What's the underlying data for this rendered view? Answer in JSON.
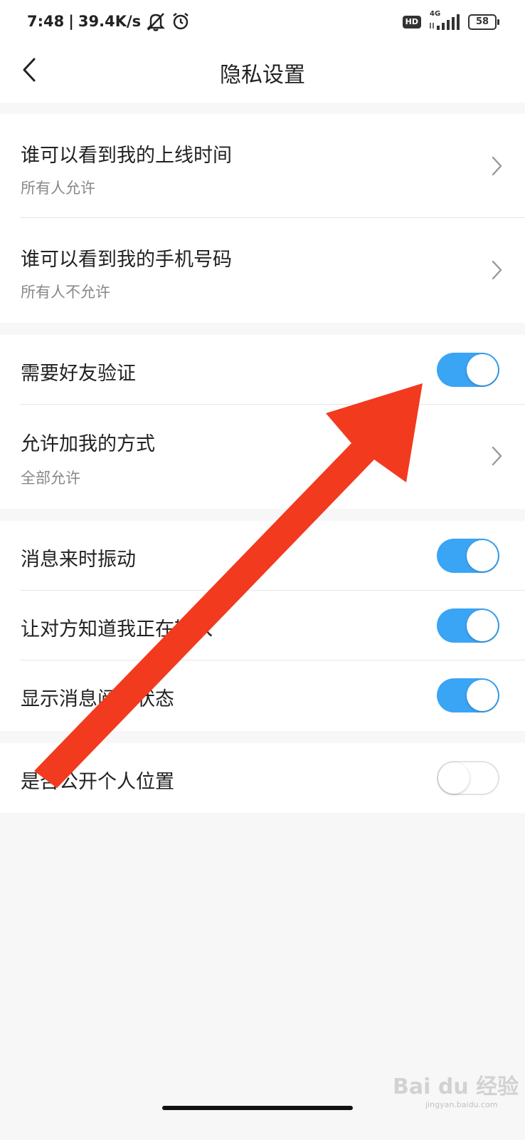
{
  "status_bar": {
    "time": "7:48",
    "separator": "|",
    "net_speed": "39.4K/s",
    "hd_label": "HD",
    "network_type": "4G",
    "battery": "58",
    "icons": [
      "mute-icon",
      "alarm-icon",
      "signal-icon",
      "battery-icon"
    ]
  },
  "header": {
    "title": "隐私设置",
    "back_icon": "chevron-left-icon"
  },
  "sections": [
    {
      "items": [
        {
          "title": "谁可以看到我的上线时间",
          "subtitle": "所有人允许",
          "control": "chevron"
        },
        {
          "title": "谁可以看到我的手机号码",
          "subtitle": "所有人不允许",
          "control": "chevron"
        }
      ]
    },
    {
      "items": [
        {
          "title": "需要好友验证",
          "control": "toggle",
          "on": true
        },
        {
          "title": "允许加我的方式",
          "subtitle": "全部允许",
          "control": "chevron"
        }
      ]
    },
    {
      "items": [
        {
          "title": "消息来时振动",
          "control": "toggle",
          "on": true
        },
        {
          "title": "让对方知道我正在输入",
          "control": "toggle",
          "on": true
        },
        {
          "title": "显示消息阅读状态",
          "control": "toggle",
          "on": true
        }
      ]
    },
    {
      "items": [
        {
          "title": "是否公开个人位置",
          "control": "toggle",
          "on": false
        }
      ]
    }
  ],
  "colors": {
    "toggle_on": "#3aa4f5",
    "annotation_arrow": "#f23a1e",
    "background": "#f7f7f7"
  },
  "watermark": {
    "text": "Bai du 经验",
    "sub": "jingyan.baidu.com"
  }
}
